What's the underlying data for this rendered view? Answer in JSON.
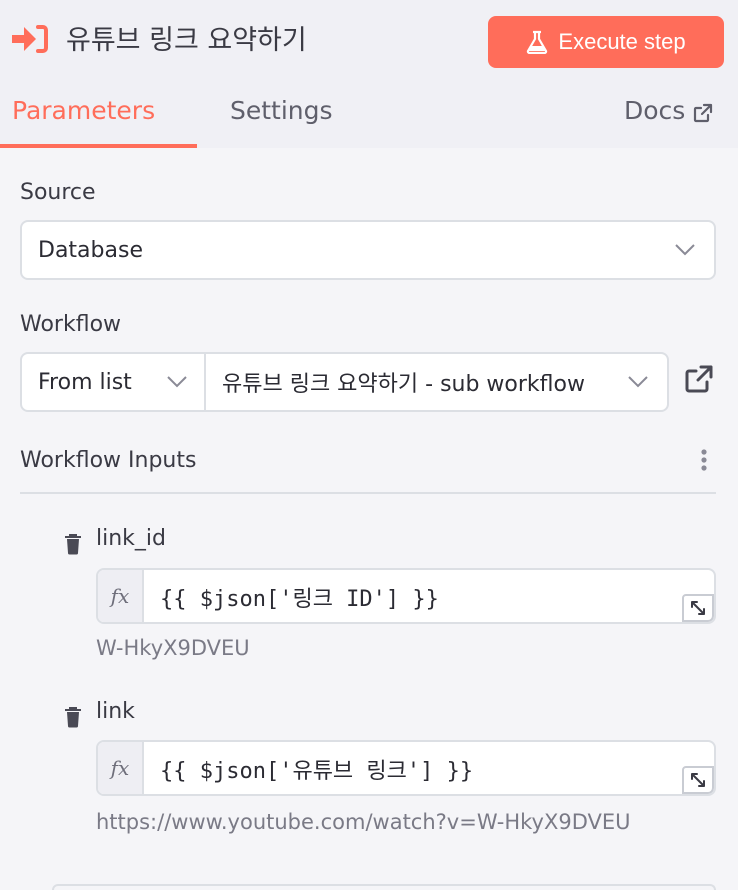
{
  "header": {
    "title": "유튜브 링크 요약하기",
    "execute_label": "Execute step",
    "accent": "#ff6d5a"
  },
  "tabs": {
    "parameters": "Parameters",
    "settings": "Settings",
    "docs": "Docs",
    "active": "parameters"
  },
  "source": {
    "label": "Source",
    "value": "Database"
  },
  "workflow": {
    "label": "Workflow",
    "mode": "From list",
    "value": "유튜브 링크 요약하기 - sub workflow"
  },
  "inputs": {
    "title": "Workflow Inputs",
    "fields": [
      {
        "name": "link_id",
        "fx": "fx",
        "expression": "{{ $json['링크 ID'] }}",
        "result": "W-HkyX9DVEU"
      },
      {
        "name": "link",
        "fx": "fx",
        "expression": "{{ $json['유튜브 링크'] }}",
        "result": "https://www.youtube.com/watch?v=W-HkyX9DVEU"
      }
    ]
  },
  "icons": {
    "node": "sign-in-arrow-icon",
    "execute": "flask-icon",
    "docs": "external-link-icon",
    "open_workflow": "external-link-icon",
    "menu": "vertical-dots-icon",
    "delete": "trash-icon",
    "expand": "expand-icon"
  }
}
